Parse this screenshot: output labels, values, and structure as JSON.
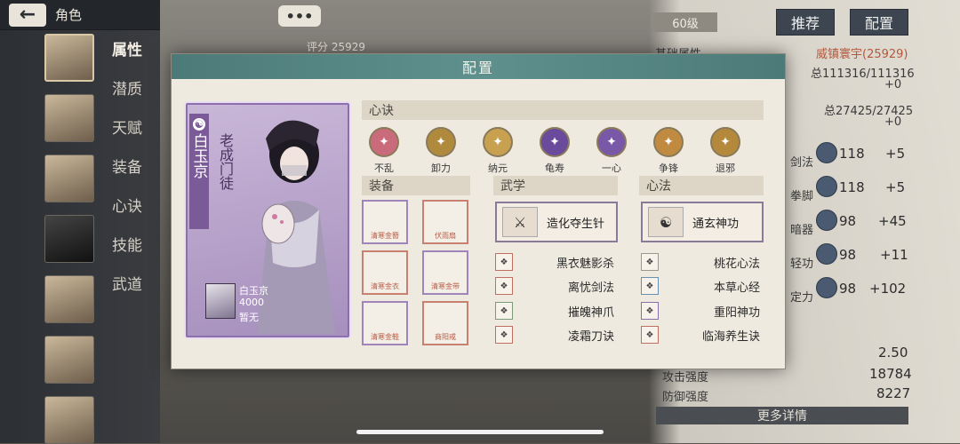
{
  "nav": {
    "back_icon": "back-arrow-icon",
    "title": "角色"
  },
  "sidebar": {
    "categories": [
      "属性",
      "潜质",
      "天赋",
      "装备",
      "心诀",
      "技能",
      "武道"
    ],
    "active": "属性"
  },
  "header": {
    "level": "60级",
    "recommend_label": "推荐",
    "config_label": "配置",
    "chat_glyph": "•••",
    "score_label": "评分",
    "score_value": "25929"
  },
  "stats_panel": {
    "section_title": "基础属性",
    "power": "威镇寰宇(25929)",
    "total_1": "总111316/111316",
    "plus_1": "+0",
    "total_2": "总27425/27425",
    "plus_2": "+0",
    "rows": [
      {
        "label": "剑法",
        "value": "118",
        "bonus": "+5"
      },
      {
        "label": "拳脚",
        "value": "118",
        "bonus": "+5"
      },
      {
        "label": "暗器",
        "value": "98",
        "bonus": "+45"
      },
      {
        "label": "轻功",
        "value": "98",
        "bonus": "+11"
      },
      {
        "label": "定力",
        "value": "98",
        "bonus": "+102"
      }
    ],
    "extra_value": "2.50",
    "attack_label": "攻击强度",
    "attack_value": "18784",
    "defense_label": "防御强度",
    "defense_value": "8227",
    "more_label": "更多详情"
  },
  "modal": {
    "title": "配置",
    "character": {
      "name": "白玉京",
      "title": "老成门徒",
      "mini_name": "白玉京",
      "mini_power": "4000",
      "mini_state": "暂无"
    },
    "xinjue_section": "心诀",
    "xinjue": [
      {
        "label": "不乱",
        "color": "#c96b7a"
      },
      {
        "label": "卸力",
        "color": "#b08a3c"
      },
      {
        "label": "纳元",
        "color": "#c7a050"
      },
      {
        "label": "龟寿",
        "color": "#6a4a9a"
      },
      {
        "label": "一心",
        "color": "#7a58a8"
      },
      {
        "label": "争锋",
        "color": "#c08a40"
      },
      {
        "label": "退邪",
        "color": "#b5893c"
      }
    ],
    "equip_section": "装备",
    "equipment": [
      {
        "tag": "清寒金簪",
        "style": "purple"
      },
      {
        "tag": "伏雨扇",
        "style": "red"
      },
      {
        "tag": "清寒金衣",
        "style": "red"
      },
      {
        "tag": "清寒金带",
        "style": "purple"
      },
      {
        "tag": "清寒金鞋",
        "style": "purple"
      },
      {
        "tag": "商阳戒",
        "style": "red"
      }
    ],
    "wuxue_section": "武学",
    "wuxue_main": "造化夺生针",
    "wuxue": [
      "黑衣魅影杀",
      "离忧剑法",
      "摧魄神爪",
      "凌霜刀诀"
    ],
    "xinfa_section": "心法",
    "xinfa_main": "通玄神功",
    "xinfa": [
      "桃花心法",
      "本草心经",
      "重阳神功",
      "临海养生诀"
    ]
  }
}
